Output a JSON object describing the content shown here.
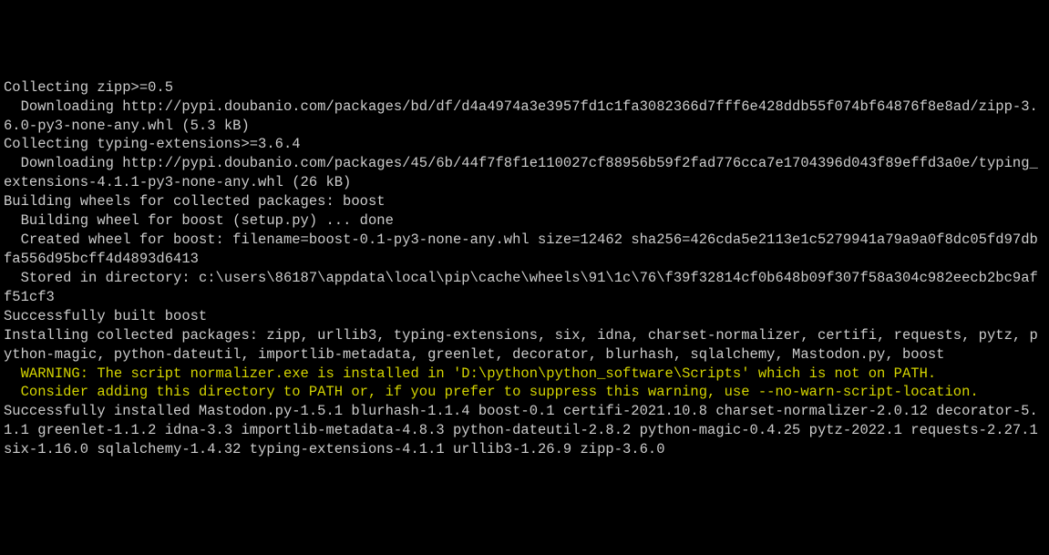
{
  "lines": [
    {
      "cls": "",
      "text": "Collecting zipp>=0.5"
    },
    {
      "cls": "",
      "text": "  Downloading http://pypi.doubanio.com/packages/bd/df/d4a4974a3e3957fd1c1fa3082366d7fff6e428ddb55f074bf64876f8e8ad/zipp-3.6.0-py3-none-any.whl (5.3 kB)"
    },
    {
      "cls": "",
      "text": "Collecting typing-extensions>=3.6.4"
    },
    {
      "cls": "",
      "text": "  Downloading http://pypi.doubanio.com/packages/45/6b/44f7f8f1e110027cf88956b59f2fad776cca7e1704396d043f89effd3a0e/typing_extensions-4.1.1-py3-none-any.whl (26 kB)"
    },
    {
      "cls": "",
      "text": "Building wheels for collected packages: boost"
    },
    {
      "cls": "",
      "text": "  Building wheel for boost (setup.py) ... done"
    },
    {
      "cls": "",
      "text": "  Created wheel for boost: filename=boost-0.1-py3-none-any.whl size=12462 sha256=426cda5e2113e1c5279941a79a9a0f8dc05fd97dbfa556d95bcff4d4893d6413"
    },
    {
      "cls": "",
      "text": "  Stored in directory: c:\\users\\86187\\appdata\\local\\pip\\cache\\wheels\\91\\1c\\76\\f39f32814cf0b648b09f307f58a304c982eecb2bc9aff51cf3"
    },
    {
      "cls": "",
      "text": "Successfully built boost"
    },
    {
      "cls": "",
      "text": "Installing collected packages: zipp, urllib3, typing-extensions, six, idna, charset-normalizer, certifi, requests, pytz, python-magic, python-dateutil, importlib-metadata, greenlet, decorator, blurhash, sqlalchemy, Mastodon.py, boost"
    },
    {
      "cls": "warn",
      "text": "  WARNING: The script normalizer.exe is installed in 'D:\\python\\python_software\\Scripts' which is not on PATH."
    },
    {
      "cls": "warn",
      "text": "  Consider adding this directory to PATH or, if you prefer to suppress this warning, use --no-warn-script-location."
    },
    {
      "cls": "",
      "text": "Successfully installed Mastodon.py-1.5.1 blurhash-1.1.4 boost-0.1 certifi-2021.10.8 charset-normalizer-2.0.12 decorator-5.1.1 greenlet-1.1.2 idna-3.3 importlib-metadata-4.8.3 python-dateutil-2.8.2 python-magic-0.4.25 pytz-2022.1 requests-2.27.1 six-1.16.0 sqlalchemy-1.4.32 typing-extensions-4.1.1 urllib3-1.26.9 zipp-3.6.0"
    }
  ]
}
